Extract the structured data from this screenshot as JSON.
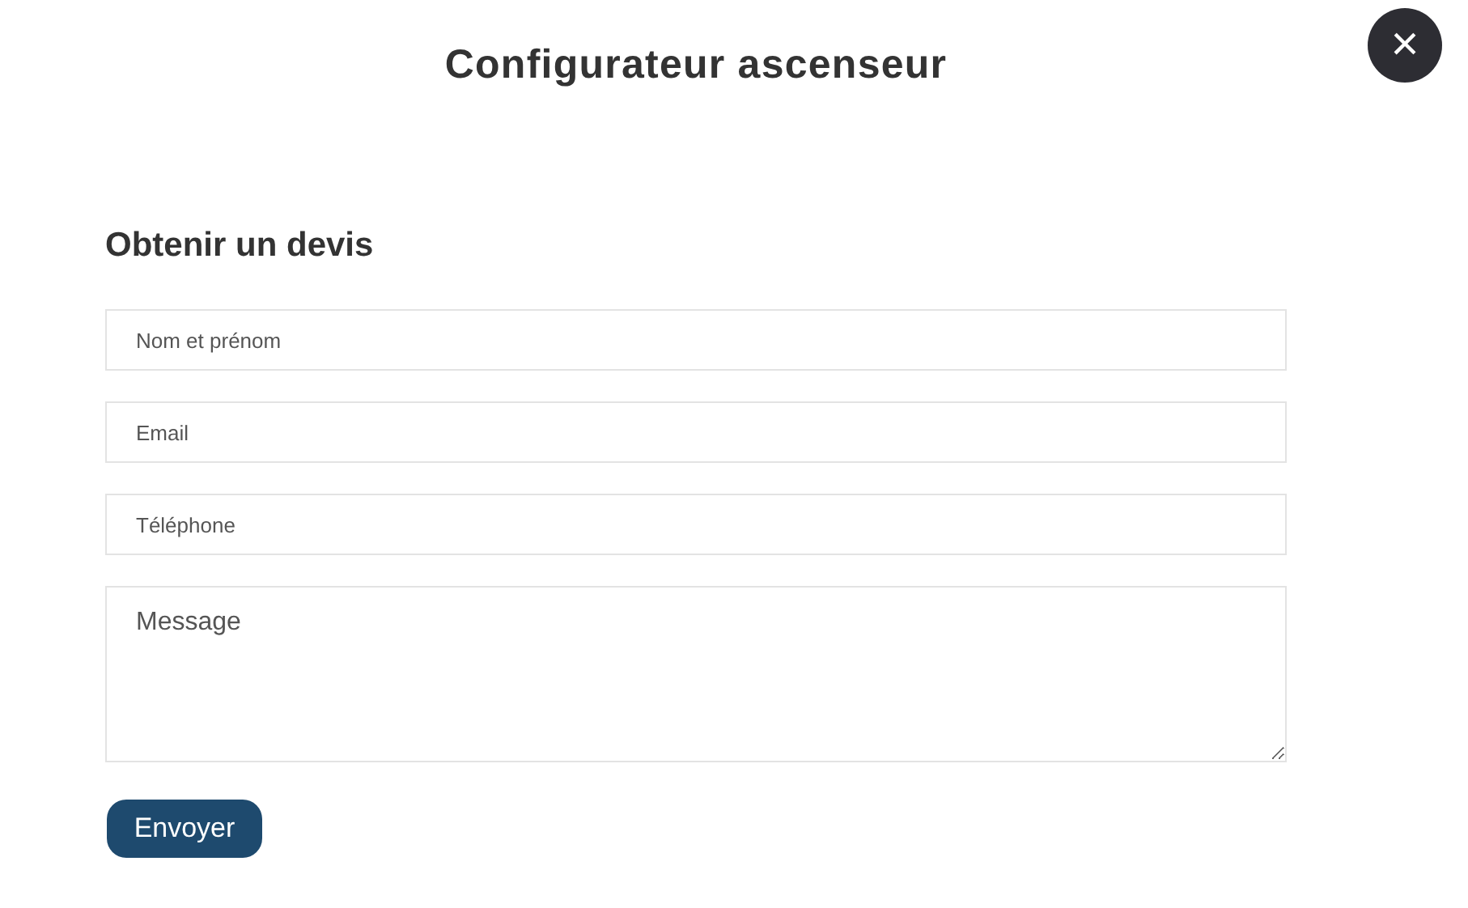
{
  "title": "Configurateur ascenseur",
  "close": {
    "symbol": "×"
  },
  "form": {
    "heading": "Obtenir un devis",
    "fields": [
      {
        "kind": "input",
        "placeholder": "Nom et prénom"
      },
      {
        "kind": "input",
        "placeholder": "Email"
      },
      {
        "kind": "input",
        "placeholder": "Téléphone"
      },
      {
        "kind": "textarea",
        "placeholder": "Message"
      }
    ],
    "submit": "Envoyer"
  }
}
